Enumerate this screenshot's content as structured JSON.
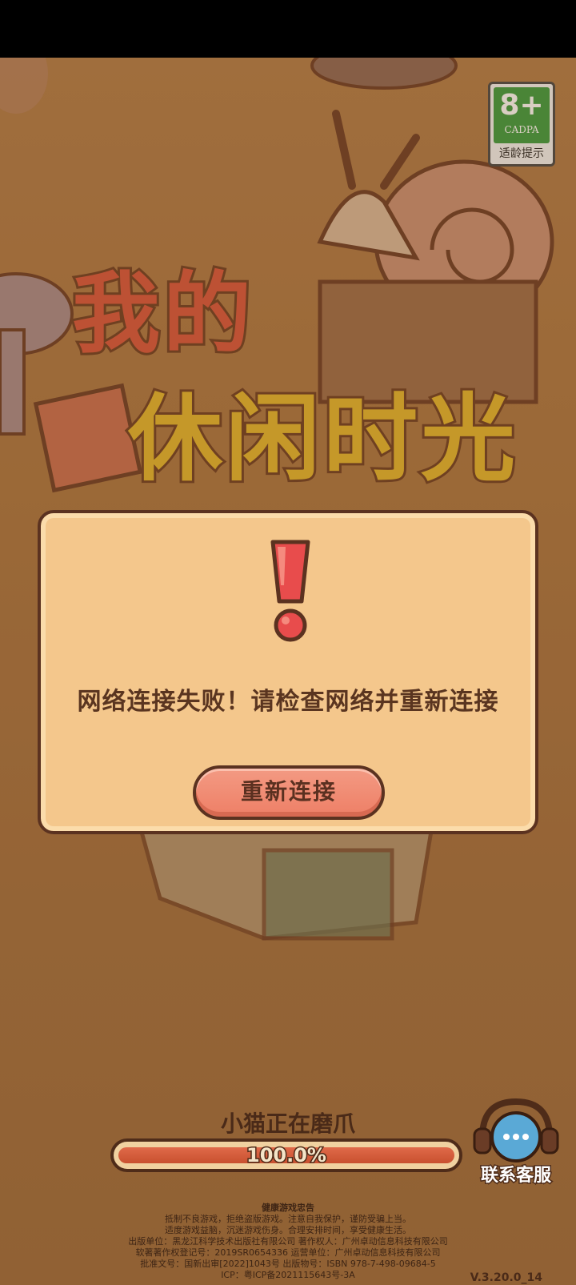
{
  "rating": {
    "age": "8+",
    "org": "CADPA",
    "tip": "适龄提示"
  },
  "title": {
    "line1": "我的",
    "line2": "休闲时光"
  },
  "dialog": {
    "message": "网络连接失败！请检查网络并重新连接",
    "button_label": "重新连接"
  },
  "loading": {
    "status": "小猫正在磨爪",
    "progress_text": "100.0%",
    "progress": 1.0
  },
  "support": {
    "label": "联系客服"
  },
  "footer": {
    "heading": "健康游戏忠告",
    "lines": [
      "抵制不良游戏，拒绝盗版游戏。注意自我保护，谨防受骗上当。",
      "适度游戏益脑，沉迷游戏伤身。合理安排时间，享受健康生活。",
      "出版单位：黑龙江科学技术出版社有限公司   著作权人：广州卓动信息科技有限公司",
      "软著著作权登记号：2019SR0654336   运营单位：广州卓动信息科技有限公司",
      "批准文号：国新出审[2022]1043号   出版物号：ISBN 978-7-498-09684-5",
      "ICP：粤ICP备2021115643号-3A"
    ]
  },
  "version": "V.3.20.0_14",
  "colors": {
    "accent": "#ee7f66",
    "dialog_bg": "#f4c78c",
    "outline": "#5b3220"
  }
}
